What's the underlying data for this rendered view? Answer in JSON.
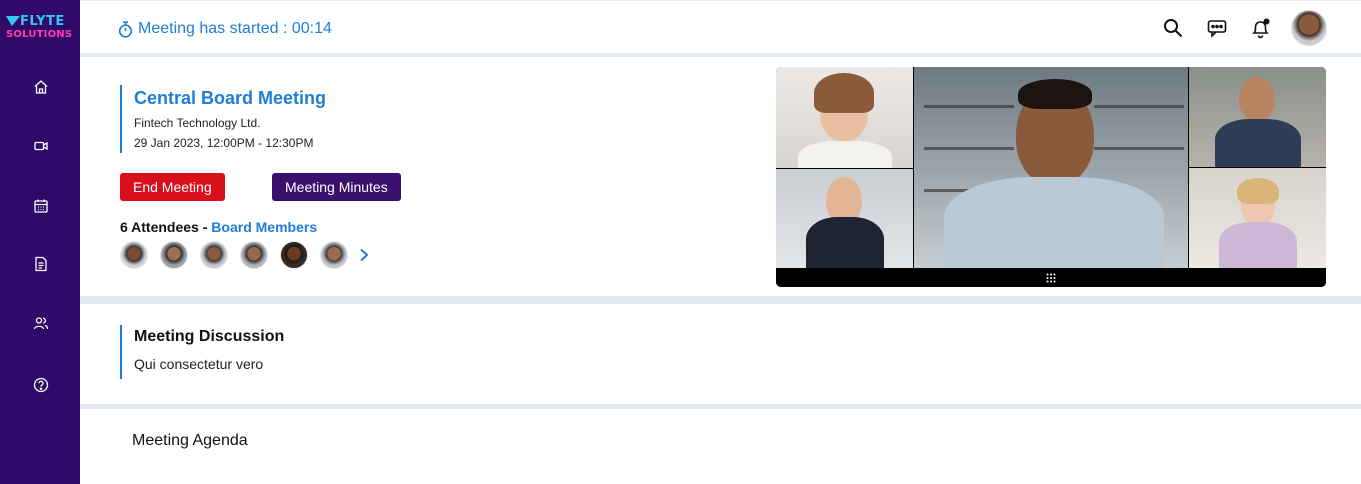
{
  "brand": {
    "line1": "FLYTE",
    "line2": "SOLUTIONS",
    "primary_color": "#2f0a68",
    "accent": "#1f7dd6"
  },
  "sidebar": {
    "items": [
      {
        "icon": "home-icon"
      },
      {
        "icon": "video-icon"
      },
      {
        "icon": "calendar-icon"
      },
      {
        "icon": "document-icon"
      },
      {
        "icon": "users-icon"
      },
      {
        "icon": "help-icon"
      }
    ]
  },
  "header": {
    "timer_text": "Meeting has started : 00:14",
    "icons": [
      "search-icon",
      "chat-icon",
      "bell-icon",
      "avatar"
    ]
  },
  "meeting": {
    "title": "Central Board Meeting",
    "organization": "Fintech Technology Ltd.",
    "datetime": "29 Jan 2023, 12:00PM - 12:30PM",
    "end_button": "End Meeting",
    "minutes_button": "Meeting Minutes",
    "attendees_count": "6 Attendees",
    "attendees_sep": " - ",
    "attendees_group": "Board Members",
    "end_color": "#d90f1c",
    "minutes_color": "#3a0f6d"
  },
  "discussion": {
    "title": "Meeting Discussion",
    "text": "Qui consectetur vero"
  },
  "agenda": {
    "title": "Meeting Agenda"
  }
}
